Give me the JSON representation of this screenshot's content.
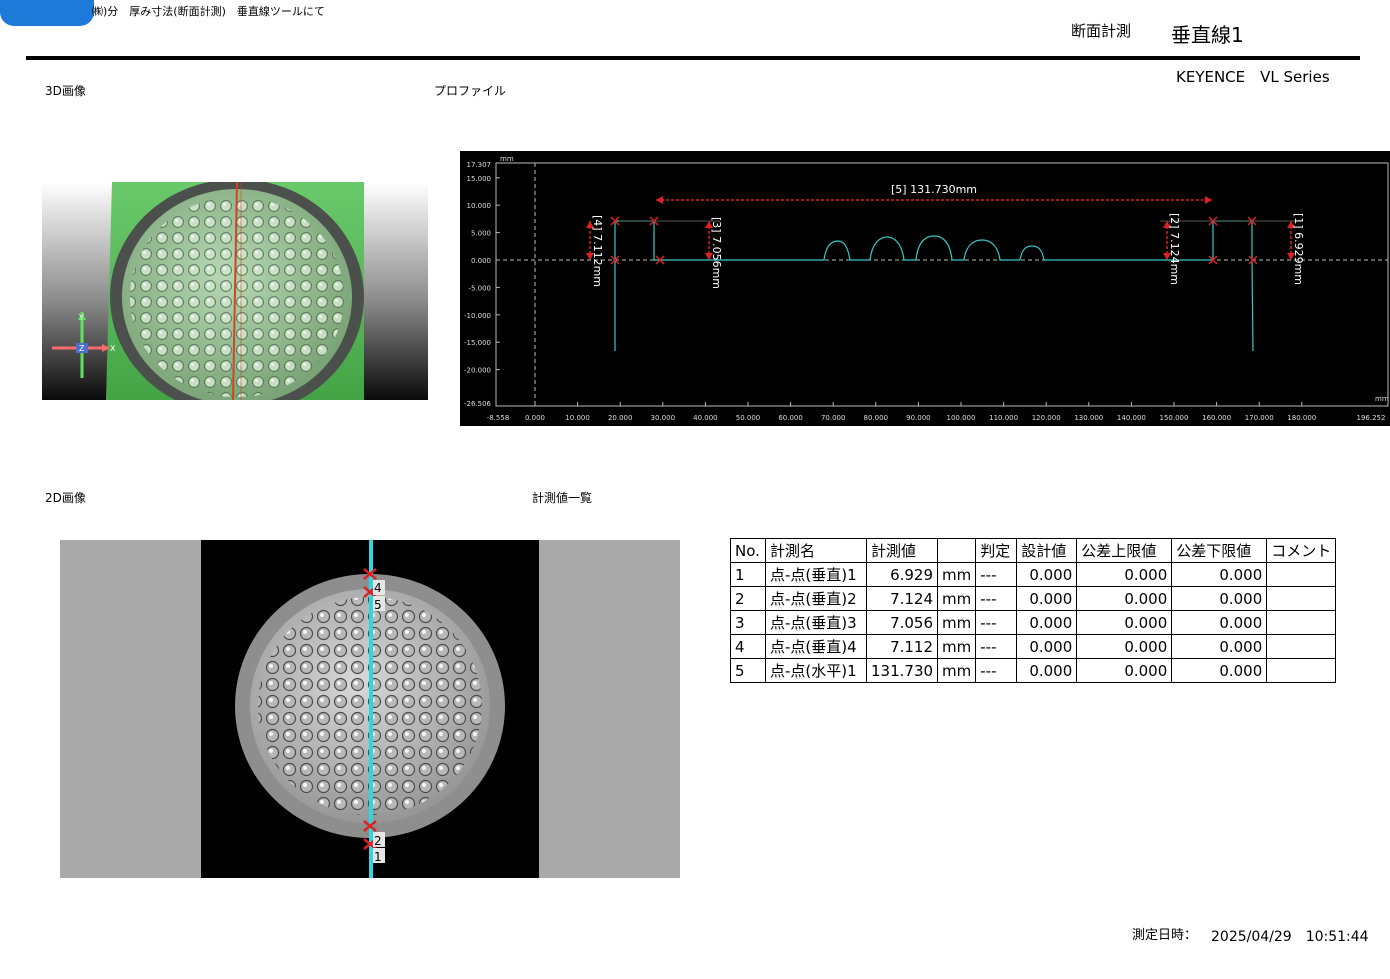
{
  "header": {
    "breadcrumb": "㈱)分　厚み寸法(断面計測)　垂直線ツールにて",
    "mode": "断面計測",
    "tool": "垂直線1",
    "brand": "KEYENCE　VL Series"
  },
  "sections": {
    "image3d": "3D画像",
    "profile": "プロファイル",
    "image2d": "2D画像",
    "measurements": "計測値一覧"
  },
  "axes3d": {
    "y": "Y",
    "z": "Z",
    "x": "X"
  },
  "profile": {
    "y_unit": "mm",
    "x_unit": "mm",
    "y_top": "17.307",
    "y_bottom": "-26.506",
    "y_ticks": [
      "15.000",
      "10.000",
      "5.000",
      "0.000",
      "-5.000",
      "-10.000",
      "-15.000",
      "-20.000"
    ],
    "x_left": "-8.558",
    "x_right": "196.252",
    "x_ticks": [
      "0.000",
      "10.000",
      "20.000",
      "30.000",
      "40.000",
      "50.000",
      "60.000",
      "70.000",
      "80.000",
      "90.000",
      "100.000",
      "110.000",
      "120.000",
      "130.000",
      "140.000",
      "150.000",
      "160.000",
      "170.000",
      "180.000"
    ],
    "annotations": {
      "a5": "[5] 131.730mm",
      "a4": "[4] 7.112mm",
      "a3": "[3] 7.056mm",
      "a2": "[2] 7.124mm",
      "a1": "[1] 6.929mm"
    }
  },
  "markers2d": {
    "m4": "4",
    "m5": "5",
    "m2": "2",
    "m1": "1"
  },
  "table": {
    "headers": [
      "No.",
      "計測名",
      "計測値",
      "",
      "判定",
      "設計値",
      "公差上限値",
      "公差下限値",
      "コメント"
    ],
    "rows": [
      [
        "1",
        "点-点(垂直)1",
        "6.929",
        "mm",
        "---",
        "0.000",
        "0.000",
        "0.000",
        ""
      ],
      [
        "2",
        "点-点(垂直)2",
        "7.124",
        "mm",
        "---",
        "0.000",
        "0.000",
        "0.000",
        ""
      ],
      [
        "3",
        "点-点(垂直)3",
        "7.056",
        "mm",
        "---",
        "0.000",
        "0.000",
        "0.000",
        ""
      ],
      [
        "4",
        "点-点(垂直)4",
        "7.112",
        "mm",
        "---",
        "0.000",
        "0.000",
        "0.000",
        ""
      ],
      [
        "5",
        "点-点(水平)1",
        "131.730",
        "mm",
        "---",
        "0.000",
        "0.000",
        "0.000",
        ""
      ]
    ]
  },
  "footer": {
    "datetime_label": "測定日時：",
    "datetime_value": "2025/04/29　10:51:44"
  }
}
